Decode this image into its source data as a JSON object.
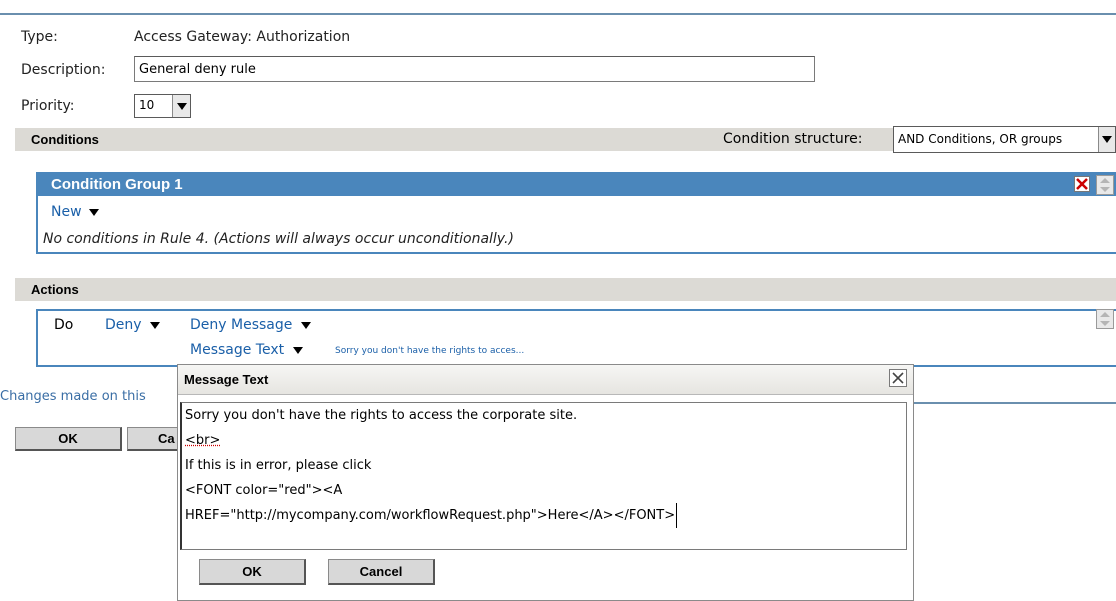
{
  "form": {
    "type_label": "Type:",
    "type_value": "Access Gateway: Authorization",
    "description_label": "Description:",
    "description_value": "General deny rule",
    "priority_label": "Priority:",
    "priority_value": "10"
  },
  "conditions": {
    "section_title": "Conditions",
    "structure_label": "Condition structure:",
    "structure_value": "AND Conditions, OR groups",
    "group_title": "Condition Group 1",
    "new_label": "New",
    "empty_message": "No conditions in Rule 4. (Actions will always occur unconditionally.)"
  },
  "actions": {
    "section_title": "Actions",
    "do_label": "Do",
    "deny_label": "Deny",
    "deny_message_label": "Deny Message",
    "message_text_label": "Message Text",
    "message_preview": "Sorry you don't have the rights to acces..."
  },
  "footer": {
    "changes_text_visible": "Changes made on this",
    "ok_label": "OK",
    "cancel_label_visible": "Ca"
  },
  "dialog": {
    "title": "Message Text",
    "lines": [
      "Sorry you don't have the rights to access the corporate site.",
      "<br>",
      "If this is in error, please click",
      "<FONT color=\"red\"><A",
      "HREF=\"http://mycompany.com/workflowRequest.php\">Here</A></FONT>"
    ],
    "ok_label": "OK",
    "cancel_label": "Cancel"
  },
  "colors": {
    "accent_blue": "#4a86bc",
    "link_blue": "#1a5fa8",
    "section_gray": "#dcdad5",
    "delete_red": "#cc0000"
  },
  "icons": {
    "group_delete": "delete-x-icon",
    "group_reorder": "up-down-arrows-icon",
    "action_reorder": "up-down-arrows-icon",
    "dialog_close": "close-icon",
    "dropdown": "chevron-down-icon"
  }
}
